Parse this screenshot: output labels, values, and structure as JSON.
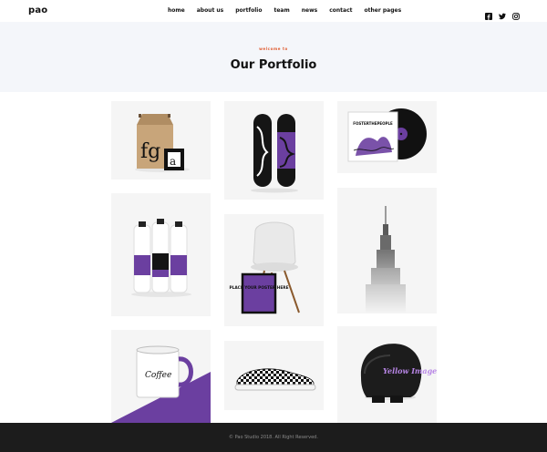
{
  "brand": {
    "logo": "pao"
  },
  "nav": {
    "items": [
      "home",
      "about us",
      "portfolio",
      "team",
      "news",
      "contact",
      "other pages"
    ]
  },
  "social": {
    "icons": [
      "facebook-icon",
      "twitter-icon",
      "instagram-icon"
    ]
  },
  "hero": {
    "kicker": "welcome to",
    "title": "Our Portfolio"
  },
  "portfolio": {
    "items": [
      {
        "name": "paper bag",
        "text": "fg"
      },
      {
        "name": "skateboards"
      },
      {
        "name": "vinyl record"
      },
      {
        "name": "milk bottles"
      },
      {
        "name": "chair poster",
        "text": "PLACE YOUR POSTER HERE"
      },
      {
        "name": "skyscraper"
      },
      {
        "name": "enamel mug",
        "text": "Coffee"
      },
      {
        "name": "sneaker"
      },
      {
        "name": "helmet",
        "text": "Yellow Image"
      }
    ]
  },
  "footer": {
    "copyright": "© Pao Studio 2018. All Right Reserved."
  },
  "colors": {
    "accent": "#e05a2e",
    "purple": "#6b3fa0",
    "footer_bg": "#1c1c1c",
    "hero_bg": "#f4f6fa"
  }
}
